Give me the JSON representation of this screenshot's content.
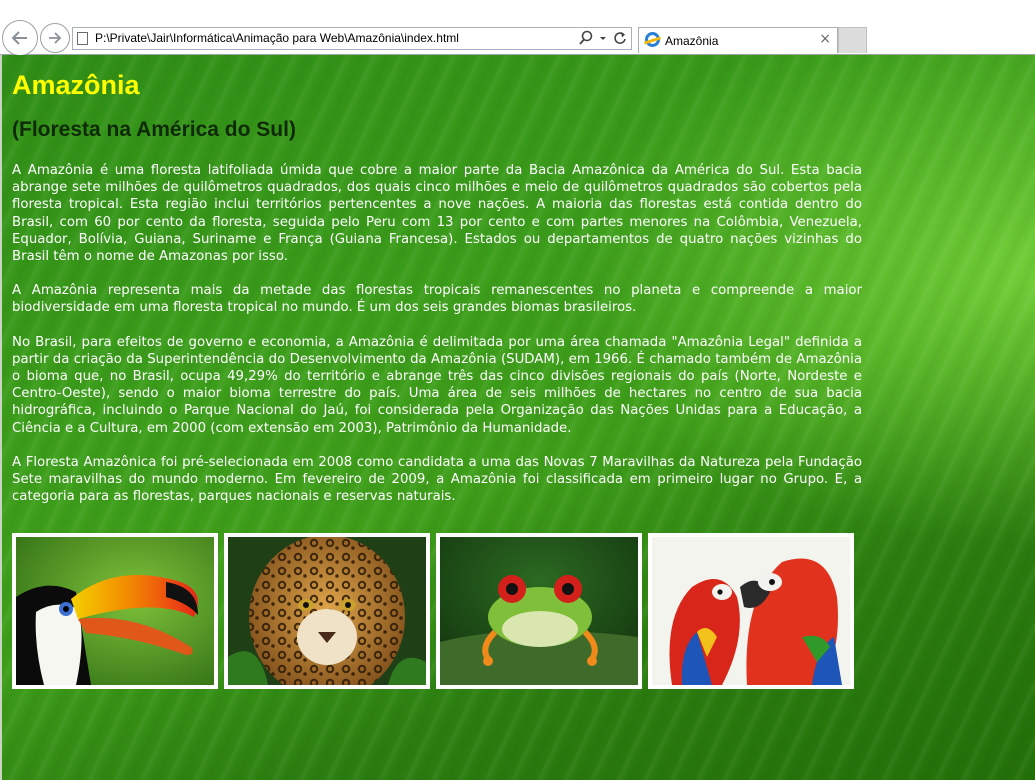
{
  "browser": {
    "url": "P:\\Private\\Jair\\Informática\\Animação para Web\\Amazônia\\index.html",
    "tab_title": "Amazônia",
    "tab_close": "×",
    "address_tools": [
      "search-icon",
      "dropdown-icon",
      "refresh-icon"
    ],
    "back_icon": "back-arrow-icon",
    "forward_icon": "forward-arrow-icon"
  },
  "page": {
    "title": "Amazônia",
    "subtitle": "(Floresta na América do Sul)",
    "paragraphs": [
      "A Amazônia é uma floresta latifoliada úmida que cobre a maior parte da Bacia Amazônica da América do Sul. Esta bacia abrange sete milhões de quilômetros quadrados, dos quais cinco milhões e meio de quilômetros quadrados são cobertos pela floresta tropical. Esta região inclui territórios pertencentes a nove nações. A maioria das florestas está contida dentro do Brasil, com 60 por cento da floresta, seguida pelo Peru com 13 por cento e com partes menores na Colômbia, Venezuela, Equador, Bolívia, Guiana, Suriname e França (Guiana Francesa). Estados ou departamentos de quatro nações vizinhas do Brasil têm o nome de Amazonas por isso.",
      "A Amazônia representa mais da metade das florestas tropicais remanescentes no planeta e compreende a maior biodiversidade em uma floresta tropical no mundo. É um dos seis grandes biomas brasileiros.",
      "No Brasil, para efeitos de governo e economia, a Amazônia é delimitada por uma área chamada \"Amazônia Legal\" definida a partir da criação da Superintendência do Desenvolvimento da Amazônia (SUDAM), em 1966. É chamado também de Amazônia o bioma que, no Brasil, ocupa 49,29% do território e abrange três das cinco divisões regionais do país (Norte, Nordeste e Centro-Oeste), sendo o maior bioma terrestre do país. Uma área de seis milhões de hectares no centro de sua bacia hidrográfica, incluindo o Parque Nacional do Jaú, foi considerada pela Organização das Nações Unidas para a Educação, a Ciência e a Cultura, em 2000 (com extensão em 2003), Patrimônio da Humanidade.",
      "A Floresta Amazônica foi pré-selecionada em 2008 como candidata a uma das Novas 7 Maravilhas da Natureza pela Fundação Sete maravilhas do mundo moderno. Em fevereiro de 2009, a Amazônia foi classificada em primeiro lugar no Grupo. E, a categoria para as florestas, parques nacionais e reservas naturais."
    ],
    "gallery": [
      "toucan-photo",
      "jaguar-photo",
      "tree-frog-photo",
      "macaws-photo"
    ]
  },
  "colors": {
    "title": "#ffff00",
    "subtitle": "#0f2a08",
    "text": "#ffffff",
    "background_green": "#3c9e1b"
  }
}
